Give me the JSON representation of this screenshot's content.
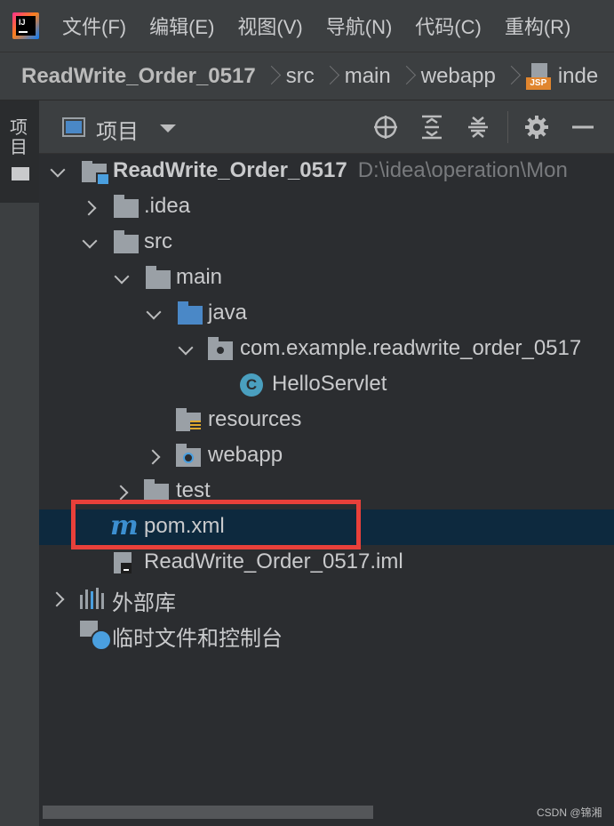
{
  "menubar": {
    "items": [
      "文件(F)",
      "编辑(E)",
      "视图(V)",
      "导航(N)",
      "代码(C)",
      "重构(R)"
    ]
  },
  "breadcrumb": {
    "items": [
      "ReadWrite_Order_0517",
      "src",
      "main",
      "webapp",
      "inde"
    ],
    "file_icon_label": "JSP"
  },
  "side_tab": {
    "label": "项目"
  },
  "toolbar": {
    "title": "项目"
  },
  "tree": {
    "project_name": "ReadWrite_Order_0517",
    "project_path": "D:\\idea\\operation\\Mon",
    "idea": ".idea",
    "src": "src",
    "main": "main",
    "java": "java",
    "package": "com.example.readwrite_order_0517",
    "servlet": "HelloServlet",
    "resources": "resources",
    "webapp": "webapp",
    "test": "test",
    "pom": "pom.xml",
    "iml": "ReadWrite_Order_0517.iml",
    "external_libraries": "外部库",
    "scratches": "临时文件和控制台"
  },
  "icon_letters": {
    "maven": "m",
    "class": "C"
  },
  "watermark": "CSDN @锦湘",
  "colors": {
    "selection": "#0d293e",
    "highlight_box": "#e8403a",
    "folder": "#9aa0a6",
    "source_folder": "#4a88c7",
    "class_icon": "#4a9fbf",
    "maven_icon": "#3c8fd0"
  }
}
